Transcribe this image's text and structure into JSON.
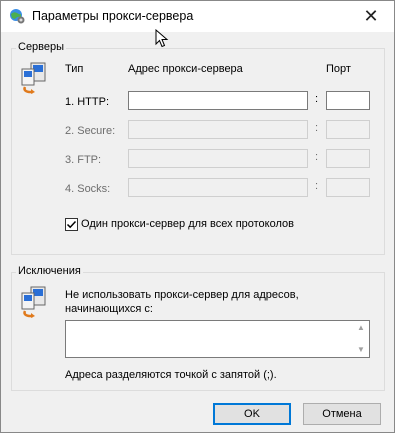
{
  "window": {
    "title": "Параметры прокси-сервера",
    "close_glyph": "✕",
    "icon": "globe-settings-icon"
  },
  "servers": {
    "group_label": "Серверы",
    "icon": "network-computer-icon",
    "col_type": "Тип",
    "col_address": "Адрес прокси-сервера",
    "col_port": "Порт",
    "rows": [
      {
        "label": "1. HTTP:",
        "address": "",
        "port": "",
        "enabled": true
      },
      {
        "label": "2. Secure:",
        "address": "",
        "port": "",
        "enabled": false
      },
      {
        "label": "3. FTP:",
        "address": "",
        "port": "",
        "enabled": false
      },
      {
        "label": "4. Socks:",
        "address": "",
        "port": "",
        "enabled": false
      }
    ],
    "separator": ":",
    "same_proxy_label": "Один прокси-сервер для всех протоколов",
    "same_proxy_checked": true
  },
  "exceptions": {
    "group_label": "Исключения",
    "icon": "network-computer-icon",
    "description": "Не использовать прокси-сервер для адресов, начинающихся с:",
    "value": "",
    "hint": "Адреса разделяются точкой с запятой (;)."
  },
  "buttons": {
    "ok": "OK",
    "cancel": "Отмена"
  }
}
